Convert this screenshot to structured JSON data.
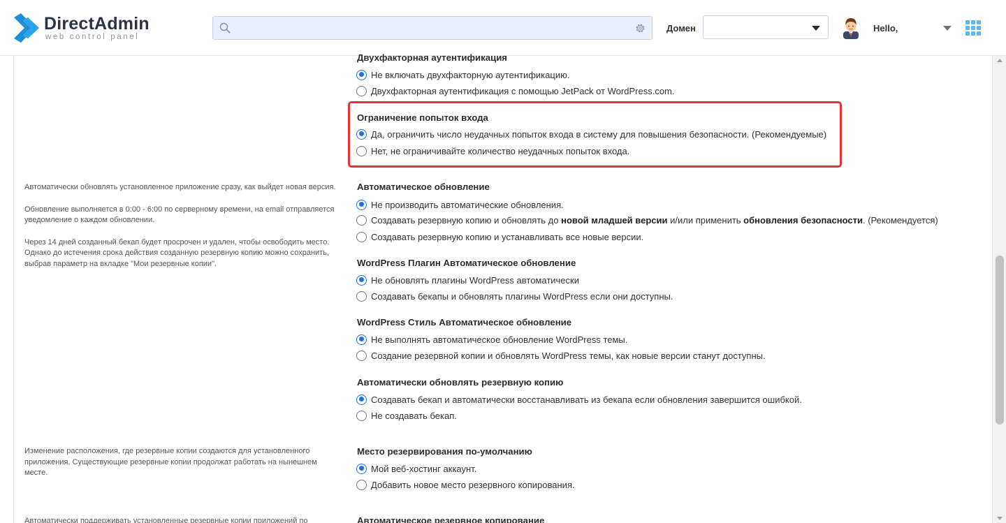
{
  "header": {
    "logo_title": "DirectAdmin",
    "logo_subtitle": "web control panel",
    "search_placeholder": "",
    "domain_label": "Домен",
    "domain_value": "",
    "greeting": "Hello,"
  },
  "colors": {
    "accent": "#1e6fe0",
    "highlight_border": "#e03238",
    "logo_blue": "#1c8fd8",
    "apps_grid": "#5bb7ec"
  },
  "help": {
    "auto_update": [
      "Автоматически обновлять установленное приложение сразу, как выйдет новая версия.",
      "Обновление выполняется в 0:00 - 6:00 по серверному времени, на email отправляется уведомление о каждом обновлении.",
      "Через 14 дней созданный бекап будет просрочен и удален, чтобы освободить место. Однако до истечения срока действия созданную резервную копию можно сохранить, выбрав параметр на вкладке \"Мои резервные копии\"."
    ],
    "backup_location": "Изменение расположения, где резервные копии создаются для установленного приложения. Существующие резервные копии продолжат работать на нынешнем месте.",
    "auto_backup": "Автоматически поддерживать установленные резервные копии приложений по"
  },
  "groups": {
    "two_factor": {
      "title": "Двухфакторная аутентификация",
      "options": [
        {
          "label": "Не включать двухфакторную аутентификацию.",
          "checked": true
        },
        {
          "label": "Двухфакторная аутентификация с помощью JetPack от WordPress.com.",
          "checked": false
        }
      ]
    },
    "login_limit": {
      "title": "Ограничение попыток входа",
      "options": [
        {
          "label": "Да, ограничить число неудачных попыток входа в систему для повышения безопасности. (Рекомендуемые)",
          "checked": true
        },
        {
          "label": "Нет, не ограничивайте количество неудачных попыток входа.",
          "checked": false
        }
      ]
    },
    "auto_update": {
      "title": "Автоматическое обновление",
      "options": [
        {
          "label": "Не производить автоматические обновления.",
          "checked": true
        },
        {
          "label_parts": [
            "Создавать резервную копию и обновлять до ",
            "новой младшей версии",
            " и/или применить ",
            "обновления безопасности",
            ". (Рекомендуется)"
          ],
          "checked": false
        },
        {
          "label": "Создавать резервную копию и устанавливать все новые версии.",
          "checked": false
        }
      ]
    },
    "plugin_update": {
      "title": "WordPress Плагин Автоматическое обновление",
      "options": [
        {
          "label": "Не обновлять плагины WordPress автоматически",
          "checked": true
        },
        {
          "label": "Создавать бекапы и обновлять плагины WordPress если они доступны.",
          "checked": false
        }
      ]
    },
    "theme_update": {
      "title": "WordPress Стиль Автоматическое обновление",
      "options": [
        {
          "label": "Не выполнять автоматическое обновление WordPress темы.",
          "checked": true
        },
        {
          "label": "Создание резервной копии и обновлять WordPress темы, как новые версии станут доступны.",
          "checked": false
        }
      ]
    },
    "backup_restore": {
      "title": "Автоматически обновлять резервную копию",
      "options": [
        {
          "label": "Создавать бекап и автоматически восстанавливать из бекапа если обновления завершится ошибкой.",
          "checked": true
        },
        {
          "label": "Не создавать бекап.",
          "checked": false
        }
      ]
    },
    "backup_location": {
      "title": "Место резервирования по-умолчанию",
      "options": [
        {
          "label": "Мой веб-хостинг аккаунт.",
          "checked": true
        },
        {
          "label": "Добавить новое место резервного копирования.",
          "checked": false
        }
      ]
    },
    "auto_backup": {
      "title": "Автоматическое резервное копирование"
    }
  }
}
